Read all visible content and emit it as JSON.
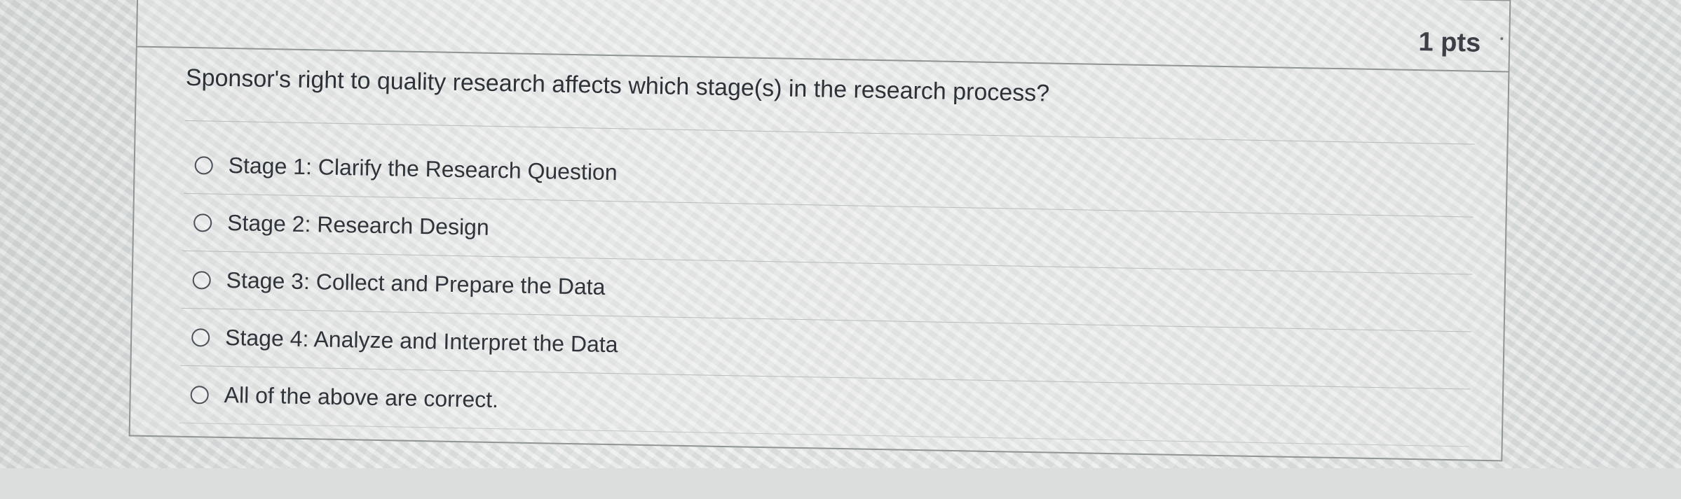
{
  "question": {
    "points": "1 pts",
    "text": "Sponsor's right to quality research affects which stage(s) in the research process?",
    "answers": [
      {
        "label": "Stage 1: Clarify the Research Question",
        "selected": false
      },
      {
        "label": "Stage 2: Research Design",
        "selected": false
      },
      {
        "label": "Stage 3: Collect and Prepare the Data",
        "selected": false
      },
      {
        "label": "Stage 4: Analyze and Interpret the Data",
        "selected": false
      },
      {
        "label": "All of the above are correct.",
        "selected": false
      }
    ]
  }
}
